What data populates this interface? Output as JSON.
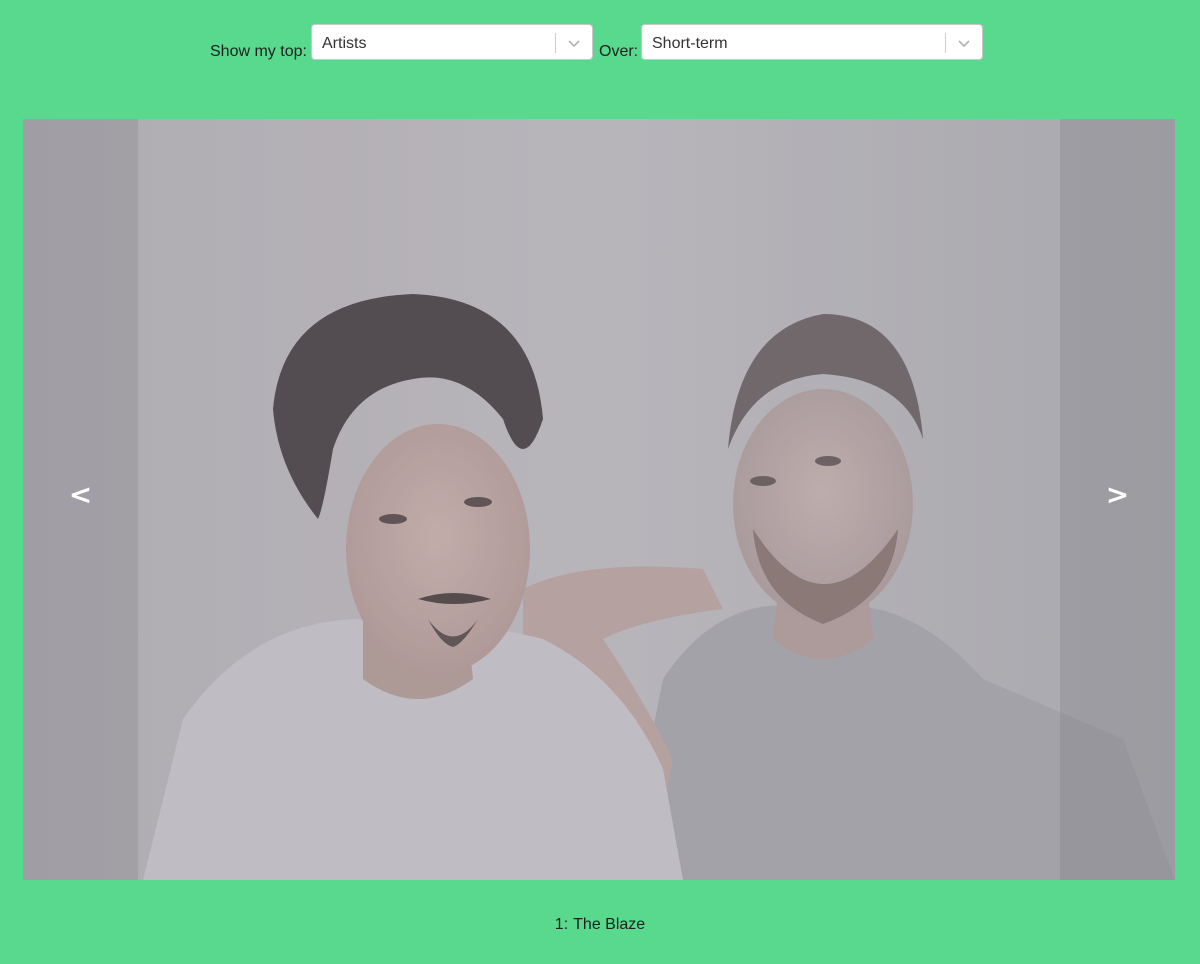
{
  "controls": {
    "show_label": "Show my top:",
    "type_select": {
      "value": "Artists"
    },
    "over_label": "Over:",
    "range_select": {
      "value": "Short-term"
    },
    "chevron_icon": "chevron-down-icon"
  },
  "carousel": {
    "prev_label": "<",
    "next_label": ">",
    "image": "artist-photo"
  },
  "caption": {
    "rank": "1",
    "name": "The Blaze"
  },
  "colors": {
    "background": "#59d98e",
    "nav_overlay": "#6e6e78",
    "nav_text": "#ffffff"
  }
}
